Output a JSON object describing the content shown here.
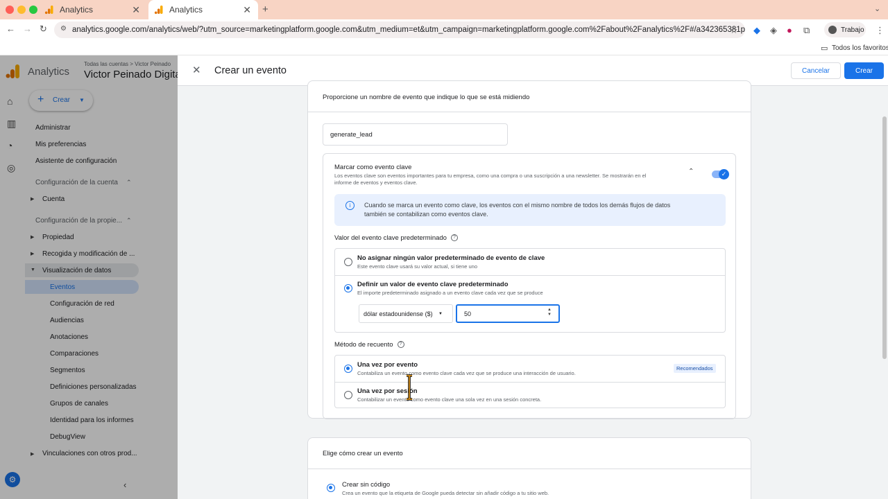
{
  "browser": {
    "tabs": [
      {
        "title": "Analytics",
        "active": false
      },
      {
        "title": "Analytics",
        "active": true
      }
    ],
    "url": "analytics.google.com/analytics/web/?utm_source=marketingplatform.google.com&utm_medium=et&utm_campaign=marketingplatform.google.com%2Fabout%2Fanalytics%2F#/a342365381p474318255/admin/e...",
    "profile": "Trabajo",
    "bookmarks_label": "Todos los favoritos"
  },
  "app": {
    "name": "Analytics",
    "breadcrumb": "Todas las cuentas > Victor Peinado",
    "property": "Victor Peinado Digita",
    "create_label": "Crear",
    "nav": {
      "admin": "Administrar",
      "prefs": "Mis preferencias",
      "setup": "Asistente de configuración",
      "account_section": "Configuración de la cuenta",
      "account": "Cuenta",
      "property_section": "Configuración de la propie...",
      "property": "Propiedad",
      "collection": "Recogida y modificación de ...",
      "display": "Visualización de datos",
      "items": [
        "Eventos",
        "Configuración de red",
        "Audiencias",
        "Anotaciones",
        "Comparaciones",
        "Segmentos",
        "Definiciones personalizadas",
        "Grupos de canales",
        "Identidad para los informes",
        "DebugView"
      ],
      "links": "Vinculaciones con otros prod..."
    }
  },
  "panel": {
    "title": "Crear un evento",
    "cancel": "Cancelar",
    "create": "Crear",
    "name_prompt": "Proporcione un nombre de evento que indique lo que se está midiendo",
    "event_name": "generate_lead",
    "key_event": {
      "title": "Marcar como evento clave",
      "desc_line1": "Los eventos clave son eventos importantes para tu empresa, como una compra o una suscripción a una newsletter. Se mostrarán en el",
      "desc_line2": "informe de eventos y eventos clave.",
      "info_line1": "Cuando se marca un evento como clave, los eventos con el mismo nombre de todos los demás flujos de datos",
      "info_line2": "también se contabilizan como eventos clave.",
      "toggle_on": true
    },
    "default_value": {
      "label": "Valor del evento clave predeterminado",
      "opt1_title": "No asignar ningún valor predeterminado de evento de clave",
      "opt1_desc": "Este evento clave usará su valor actual, si tiene uno",
      "opt2_title": "Definir un valor de evento clave predeterminado",
      "opt2_desc": "El importe predeterminado asignado a un evento clave cada vez que se produce",
      "currency": "dólar estadounidense ($)",
      "amount": "50"
    },
    "counting": {
      "label": "Método de recuento",
      "opt1_title": "Una vez por evento",
      "opt1_desc": "Contabiliza un evento como evento clave cada vez que se produce una interacción de usuario.",
      "recommended": "Recomendados",
      "opt2_title": "Una vez por sesión",
      "opt2_desc": "Contabilizar un evento como evento clave una sola vez en una sesión concreta."
    },
    "create_method": {
      "label": "Elige cómo crear un evento",
      "opt1_title": "Crear sin código",
      "opt1_desc": "Crea un evento que la etiqueta de Google pueda detectar sin añadir código a tu sitio web."
    }
  },
  "colors": {
    "accent": "#1a73e8",
    "tabbar": "#f8d4c4",
    "info_bg": "#e8f0fe"
  }
}
